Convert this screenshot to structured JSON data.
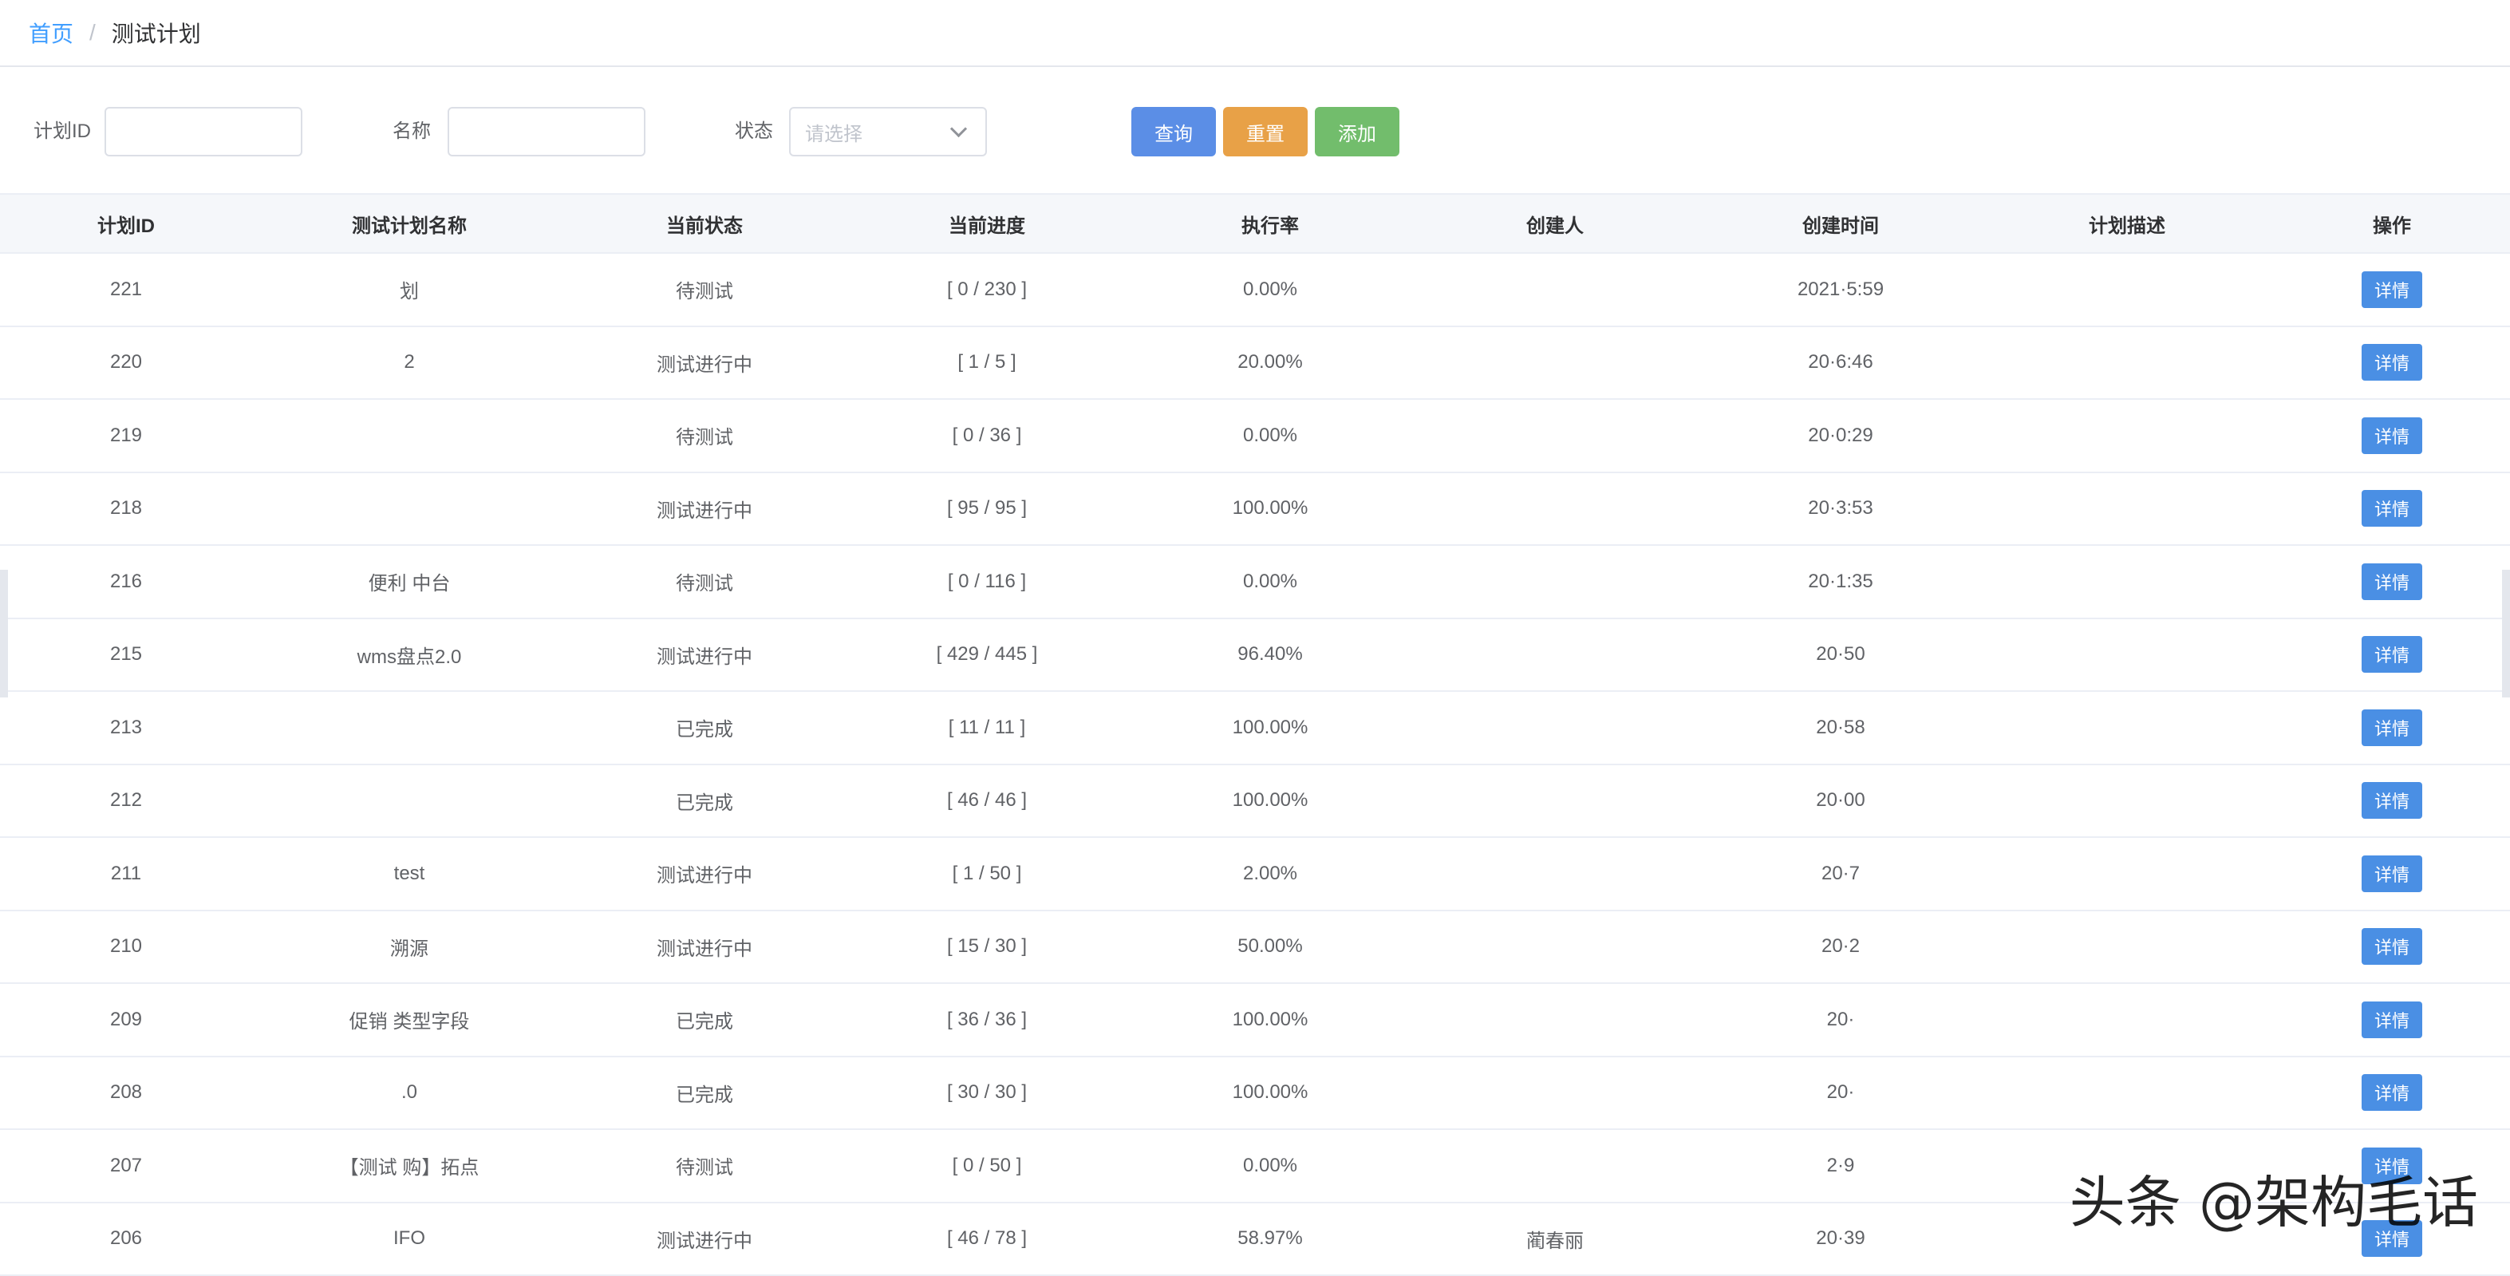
{
  "breadcrumb": {
    "home": "首页",
    "current": "测试计划"
  },
  "filters": {
    "plan_id_label": "计划ID",
    "plan_id_value": "",
    "name_label": "名称",
    "name_value": "",
    "status_label": "状态",
    "status_placeholder": "请选择"
  },
  "buttons": {
    "query": "查询",
    "reset": "重置",
    "add": "添加"
  },
  "colors": {
    "query": "#5b8ee6",
    "reset": "#e8a147",
    "add": "#72bd6c",
    "detail": "#4a8fe4",
    "link": "#409eff"
  },
  "table": {
    "headers": [
      "计划ID",
      "测试计划名称",
      "当前状态",
      "当前进度",
      "执行率",
      "创建人",
      "创建时间",
      "计划描述",
      "操作"
    ],
    "detail_label": "详情",
    "rows": [
      {
        "id": "221",
        "name": "划",
        "status": "待测试",
        "progress": "[ 0 / 230 ]",
        "rate": "0.00%",
        "creator": "",
        "time": "2021·5:59",
        "desc": ""
      },
      {
        "id": "220",
        "name": "2",
        "status": "测试进行中",
        "progress": "[ 1 / 5 ]",
        "rate": "20.00%",
        "creator": "",
        "time": "20·6:46",
        "desc": ""
      },
      {
        "id": "219",
        "name": "",
        "status": "待测试",
        "progress": "[ 0 / 36 ]",
        "rate": "0.00%",
        "creator": "",
        "time": "20·0:29",
        "desc": ""
      },
      {
        "id": "218",
        "name": "",
        "status": "测试进行中",
        "progress": "[ 95 / 95 ]",
        "rate": "100.00%",
        "creator": "",
        "time": "20·3:53",
        "desc": ""
      },
      {
        "id": "216",
        "name": "便利 中台",
        "status": "待测试",
        "progress": "[ 0 / 116 ]",
        "rate": "0.00%",
        "creator": "",
        "time": "20·1:35",
        "desc": ""
      },
      {
        "id": "215",
        "name": "wms盘点2.0",
        "status": "测试进行中",
        "progress": "[ 429 / 445 ]",
        "rate": "96.40%",
        "creator": "",
        "time": "20·50",
        "desc": ""
      },
      {
        "id": "213",
        "name": "",
        "status": "已完成",
        "progress": "[ 11 / 11 ]",
        "rate": "100.00%",
        "creator": "",
        "time": "20·58",
        "desc": ""
      },
      {
        "id": "212",
        "name": "",
        "status": "已完成",
        "progress": "[ 46 / 46 ]",
        "rate": "100.00%",
        "creator": "",
        "time": "20·00",
        "desc": ""
      },
      {
        "id": "211",
        "name": "test",
        "status": "测试进行中",
        "progress": "[ 1 / 50 ]",
        "rate": "2.00%",
        "creator": "",
        "time": "20·7",
        "desc": ""
      },
      {
        "id": "210",
        "name": "溯源",
        "status": "测试进行中",
        "progress": "[ 15 / 30 ]",
        "rate": "50.00%",
        "creator": "",
        "time": "20·2",
        "desc": ""
      },
      {
        "id": "209",
        "name": "促销 类型字段",
        "status": "已完成",
        "progress": "[ 36 / 36 ]",
        "rate": "100.00%",
        "creator": "",
        "time": "20·",
        "desc": ""
      },
      {
        "id": "208",
        "name": ".0",
        "status": "已完成",
        "progress": "[ 30 / 30 ]",
        "rate": "100.00%",
        "creator": "",
        "time": "20·",
        "desc": ""
      },
      {
        "id": "207",
        "name": "【测试 购】拓点",
        "status": "待测试",
        "progress": "[ 0 / 50 ]",
        "rate": "0.00%",
        "creator": "",
        "time": "2·9",
        "desc": ""
      },
      {
        "id": "206",
        "name": "IFO",
        "status": "测试进行中",
        "progress": "[ 46 / 78 ]",
        "rate": "58.97%",
        "creator": "蔺春丽",
        "time": "20·39",
        "desc": ""
      }
    ]
  },
  "watermark": "头条 @架构毛话"
}
